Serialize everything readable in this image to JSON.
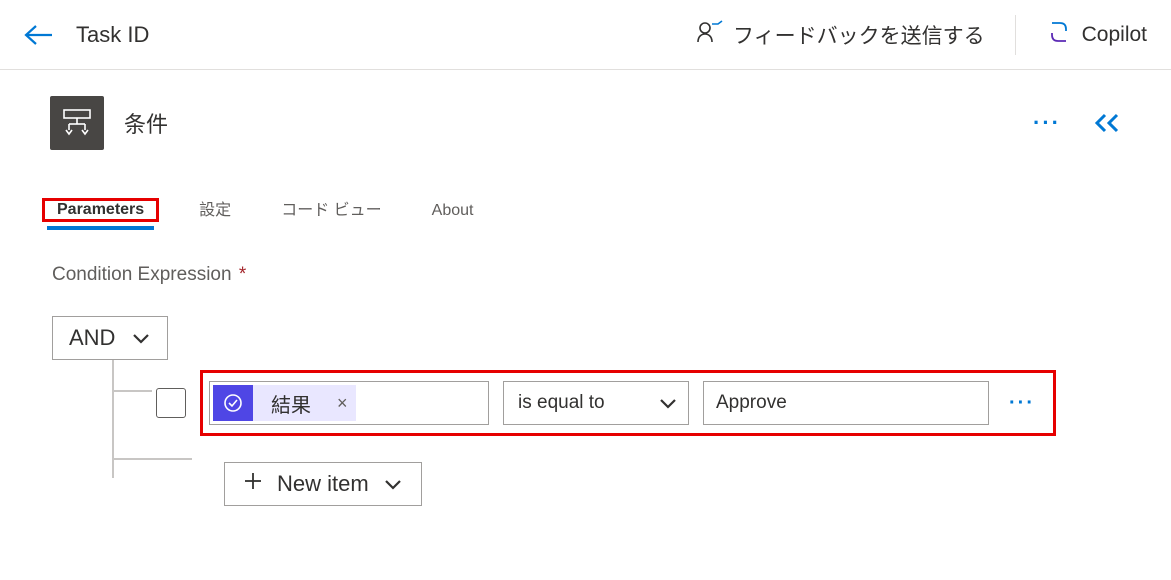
{
  "header": {
    "title": "Task ID",
    "feedback": "フィードバックを送信する",
    "copilot": "Copilot"
  },
  "action": {
    "title": "条件",
    "more": "···"
  },
  "tabs": [
    {
      "id": "parameters",
      "label": "Parameters",
      "active": true
    },
    {
      "id": "settings",
      "label": "設定",
      "active": false
    },
    {
      "id": "codeview",
      "label": "コード ビュー",
      "active": false
    },
    {
      "id": "about",
      "label": "About",
      "active": false
    }
  ],
  "expression": {
    "label": "Condition Expression",
    "required": "*",
    "logic_operator": "AND",
    "row": {
      "left_token": "結果",
      "operator": "is equal to",
      "right_value": "Approve"
    },
    "row_more": "···",
    "new_item_label": "New item"
  },
  "colors": {
    "accent": "#0078d4",
    "danger_highlight": "#e60000",
    "token_icon_bg": "#4f46e5",
    "token_bg": "#e9e7ff"
  }
}
